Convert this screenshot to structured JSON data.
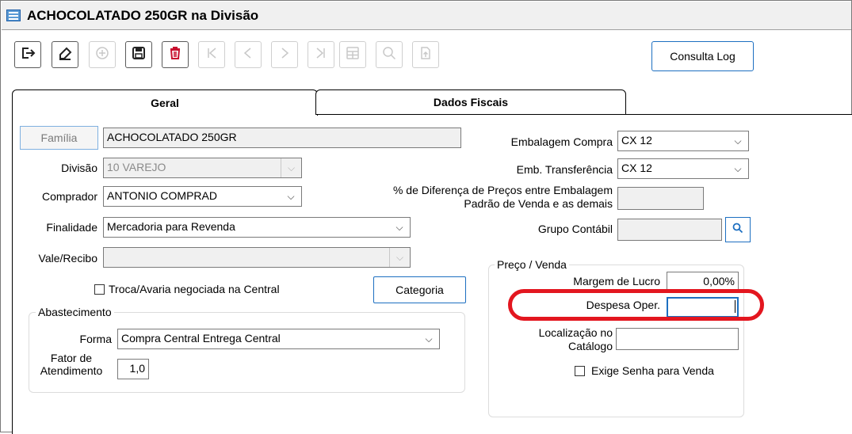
{
  "window": {
    "title": "ACHOCOLATADO 250GR na Divisão"
  },
  "toolbar": {
    "exit_icon": "exit-icon",
    "clear_icon": "eraser-icon",
    "add_icon": "plus-circle-icon",
    "save_icon": "save-icon",
    "delete_icon": "trash-icon",
    "first_icon": "first-record-icon",
    "prev_icon": "previous-icon",
    "next_icon": "next-icon",
    "last_icon": "last-record-icon",
    "grid_icon": "grid-icon",
    "search_icon": "search-icon",
    "export_icon": "export-icon",
    "consulta_log_label": "Consulta Log"
  },
  "tabs": [
    {
      "label": "Geral",
      "active": true
    },
    {
      "label": "Dados Fiscais",
      "active": false
    }
  ],
  "form": {
    "familia_button": "Família",
    "familia_value": "ACHOCOLATADO 250GR",
    "divisao_label": "Divisão",
    "divisao_value": "10 VAREJO",
    "comprador_label": "Comprador",
    "comprador_value": "ANTONIO COMPRAD",
    "finalidade_label": "Finalidade",
    "finalidade_value": "Mercadoria para Revenda",
    "vale_recibo_label": "Vale/Recibo",
    "vale_recibo_value": "",
    "troca_avaria_label": "Troca/Avaria negociada na Central",
    "troca_avaria_checked": false,
    "categoria_button": "Categoria",
    "embalagem_compra_label": "Embalagem Compra",
    "embalagem_compra_value": "CX 12",
    "emb_transferencia_label": "Emb. Transferência",
    "emb_transferencia_value": "CX 12",
    "dif_precos_label_line1": "% de Diferença de Preços entre Embalagem",
    "dif_precos_label_line2": "Padrão de Venda e as demais",
    "dif_precos_value": "",
    "grupo_contabil_label": "Grupo Contábil",
    "grupo_contabil_value": ""
  },
  "abastecimento": {
    "title": "Abastecimento",
    "forma_label": "Forma",
    "forma_value": "Compra Central Entrega Central",
    "fator_label_line1": "Fator de",
    "fator_label_line2": "Atendimento",
    "fator_value": "1,0"
  },
  "preco_venda": {
    "title": "Preço / Venda",
    "margem_label": "Margem de Lucro",
    "margem_value": "0,00%",
    "despesa_label": "Despesa Oper.",
    "despesa_value": "",
    "localizacao_label_line1": "Localização no",
    "localizacao_label_line2": "Catálogo",
    "localizacao_value": "",
    "exige_senha_label": "Exige Senha para Venda",
    "exige_senha_checked": false
  },
  "colors": {
    "accent_blue": "#1d6fc1",
    "highlight_red": "#e3161f",
    "delete_red": "#c8102e"
  }
}
